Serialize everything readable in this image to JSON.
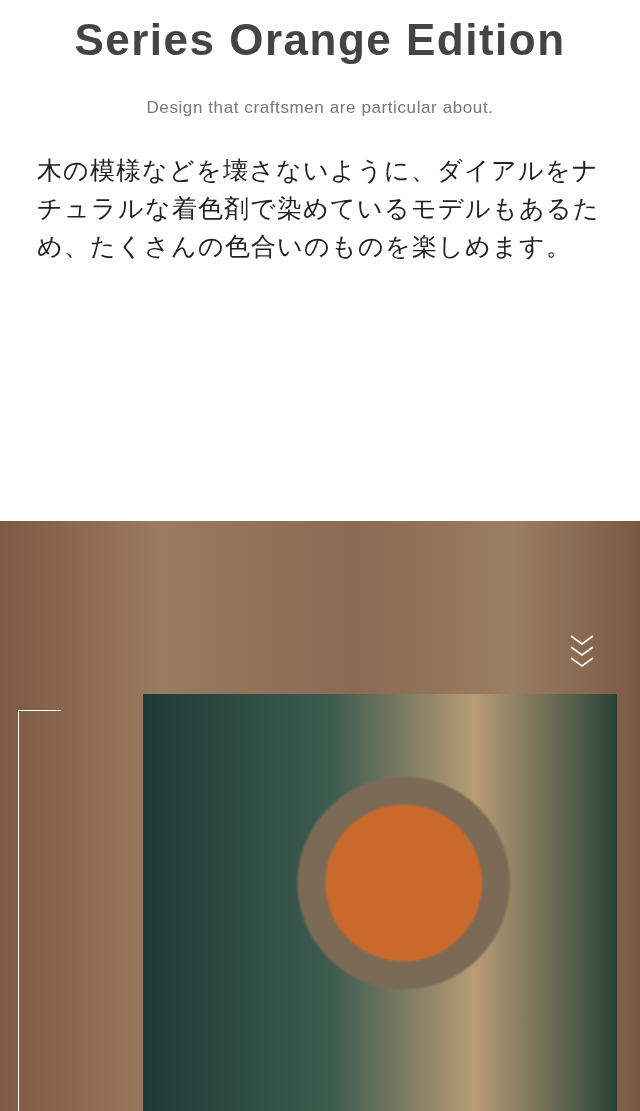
{
  "heading": {
    "title": "Series Orange Edition",
    "subtitle": "Design that craftsmen are particular about."
  },
  "description": "木の模様などを壊さないように、ダイアルをナチュラルな着色剤で染めているモデルもあるため、たくさんの色合いのものを楽しめます。"
}
